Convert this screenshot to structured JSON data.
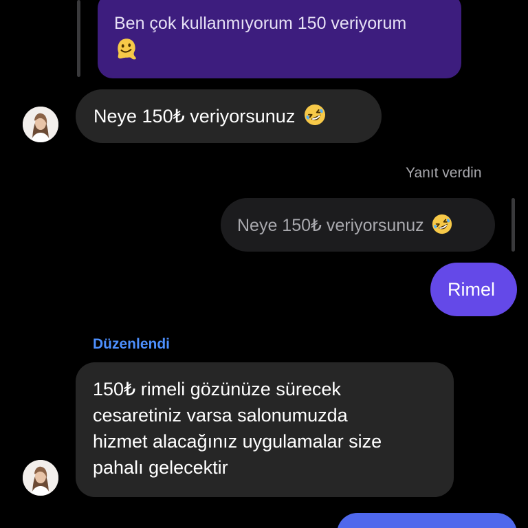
{
  "colors": {
    "background": "#000000",
    "incoming_bubble": "#262626",
    "outgoing_quoted_bubble": "#3d1d7e",
    "outgoing_bubble": "#6449e8",
    "reply_quote_bubble": "#1c1c1e",
    "edited_label": "#4d90fe",
    "meta_text": "#a8a8ad"
  },
  "messages": {
    "quoted_outgoing": {
      "text": "Ben çok kullanmıyorum 150 veriyorum",
      "emoji": "melting-face-emoji"
    },
    "incoming_1": {
      "text": "Neye 150₺ veriyorsunuz",
      "emoji": "rolling-on-floor-laughing-emoji"
    },
    "reply_status": "Yanıt verdin",
    "reply_quote": {
      "text": "Neye 150₺ veriyorsunuz",
      "emoji": "rolling-on-floor-laughing-emoji"
    },
    "outgoing_1": {
      "text": "Rimel"
    },
    "edited_label": "Düzenlendi",
    "incoming_2": {
      "lines": [
        "150₺ rimeli gözünüze sürecek",
        "cesaretiniz varsa salonumuzda",
        "hizmet alacağınız uygulamalar size",
        "pahalı gelecektir"
      ]
    }
  }
}
